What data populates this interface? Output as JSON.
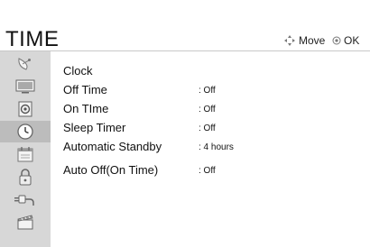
{
  "header": {
    "title": "TIME",
    "move_hint": "Move",
    "ok_hint": "OK"
  },
  "sidebar": {
    "items": [
      {
        "icon": "satellite-dish-icon",
        "active": false
      },
      {
        "icon": "monitor-icon",
        "active": false
      },
      {
        "icon": "speaker-icon",
        "active": false
      },
      {
        "icon": "clock-icon",
        "active": true
      },
      {
        "icon": "calendar-icon",
        "active": false
      },
      {
        "icon": "lock-icon",
        "active": false
      },
      {
        "icon": "plug-icon",
        "active": false
      },
      {
        "icon": "clapperboard-icon",
        "active": false
      }
    ]
  },
  "menu": {
    "items": [
      {
        "label": "Clock",
        "value": ""
      },
      {
        "label": "Off Time",
        "value": ": Off"
      },
      {
        "label": "On TIme",
        "value": ": Off"
      },
      {
        "label": "Sleep Timer",
        "value": ": Off"
      },
      {
        "label": "Automatic Standby",
        "value": ": 4 hours"
      },
      {
        "label": "Auto Off(On Time)",
        "value": ": Off"
      }
    ]
  }
}
